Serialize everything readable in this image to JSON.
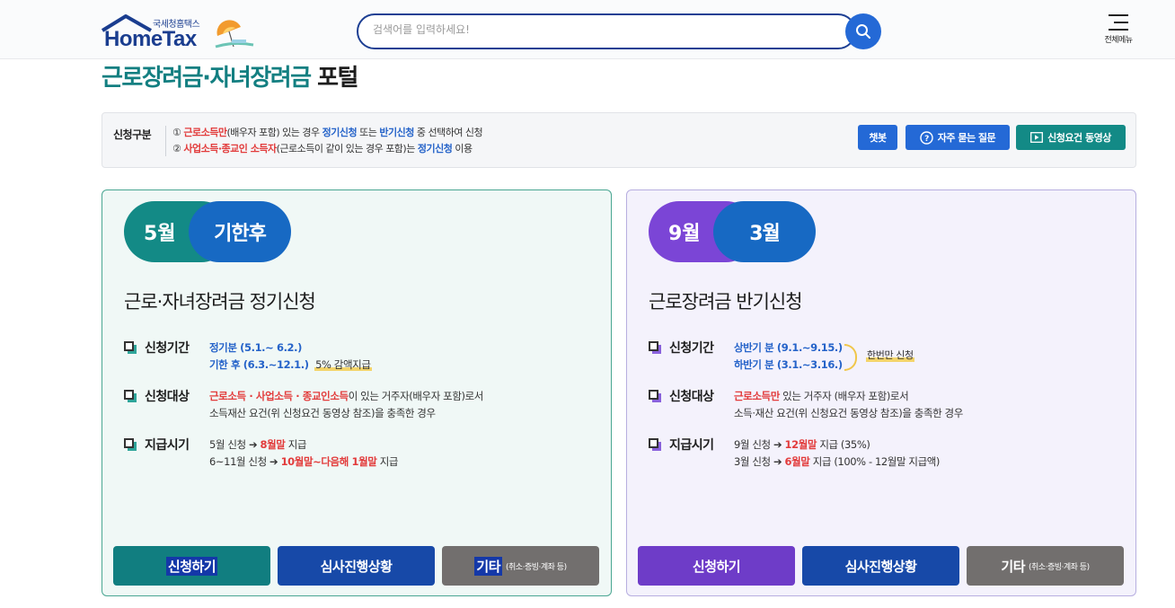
{
  "header": {
    "logo_sub": "국세청홈택스",
    "logo_main": "HomeTax",
    "search_placeholder": "검색어를 입력하세요!",
    "menu_label": "전체메뉴"
  },
  "title": {
    "green": "근로장려금·자녀장려금",
    "dark": " 포털"
  },
  "notice": {
    "label": "신청구분",
    "line1": {
      "num": "①",
      "red": "근로소득만",
      "t1": "(배우자 포함) 있는 경우 ",
      "blue1": "정기신청",
      "t2": " 또는 ",
      "blue2": "반기신청",
      "t3": " 중 선택하여 신청"
    },
    "line2": {
      "num": "②",
      "red": "사업소득·종교인 소득자",
      "t1": "(근로소득이 같이 있는 경우 포함)는 ",
      "blue1": "정기신청",
      "t2": " 이용"
    },
    "buttons": {
      "chatbot": "챗봇",
      "faq": "자주 묻는 질문",
      "video": "신청요건 동영상"
    }
  },
  "cards": {
    "left": {
      "pill_a": "5월",
      "pill_b": "기한후",
      "title": "근로·자녀장려금 정기신청",
      "period": {
        "label": "신청기간",
        "line1": "정기분 (5.1.~ 6.2.)",
        "line2": "기한 후 (6.3.~12.1.)",
        "note": "5% 감액지급"
      },
      "target": {
        "label": "신청대상",
        "red": "근로소득 · 사업소득 · 종교인소득",
        "t1": "이 있는 거주자(배우자 포함)로서",
        "line2": "소득재산 요건(위 신청요건 동영상 참조)을 충족한 경우"
      },
      "payment": {
        "label": "지급시기",
        "l1a": "5월 신청 ",
        "arrow": "➔",
        "l1red": "8월말",
        "l1b": " 지급",
        "l2a": "6~11월 신청 ",
        "l2red": "10월말~다음해 1월말",
        "l2b": " 지급"
      },
      "buttons": {
        "apply": "신청하기",
        "status": "심사진행상황",
        "other": "기타",
        "other_small": "(취소·증빙·계좌 등)"
      }
    },
    "right": {
      "pill_a": "9월",
      "pill_b": "3월",
      "title": "근로장려금 반기신청",
      "period": {
        "label": "신청기간",
        "line1": "상반기 분 (9.1.~9.15.)",
        "line2": "하반기 분 (3.1.~3.16.)",
        "note": "한번만 신청"
      },
      "target": {
        "label": "신청대상",
        "red": "근로소득만",
        "t1": " 있는 거주자 (배우자 포함)로서",
        "line2": "소득·재산 요건(위 신청요건 동영상 참조)을 충족한 경우"
      },
      "payment": {
        "label": "지급시기",
        "l1a": "9월 신청 ",
        "arrow": "➔",
        "l1red": "12월말",
        "l1b": " 지급 (35%)",
        "l2a": "3월 신청 ",
        "l2red": "6월말",
        "l2b": " 지급 (100% - 12월말 지급액)"
      },
      "buttons": {
        "apply": "신청하기",
        "status": "심사진행상황",
        "other": "기타",
        "other_small": "(취소·증빙·계좌 등)"
      }
    }
  },
  "colors": {
    "teal": "#138a86",
    "blue": "#1769c3",
    "purple": "#7b45d6",
    "red": "#e23b3b",
    "navy": "#1749a8"
  }
}
